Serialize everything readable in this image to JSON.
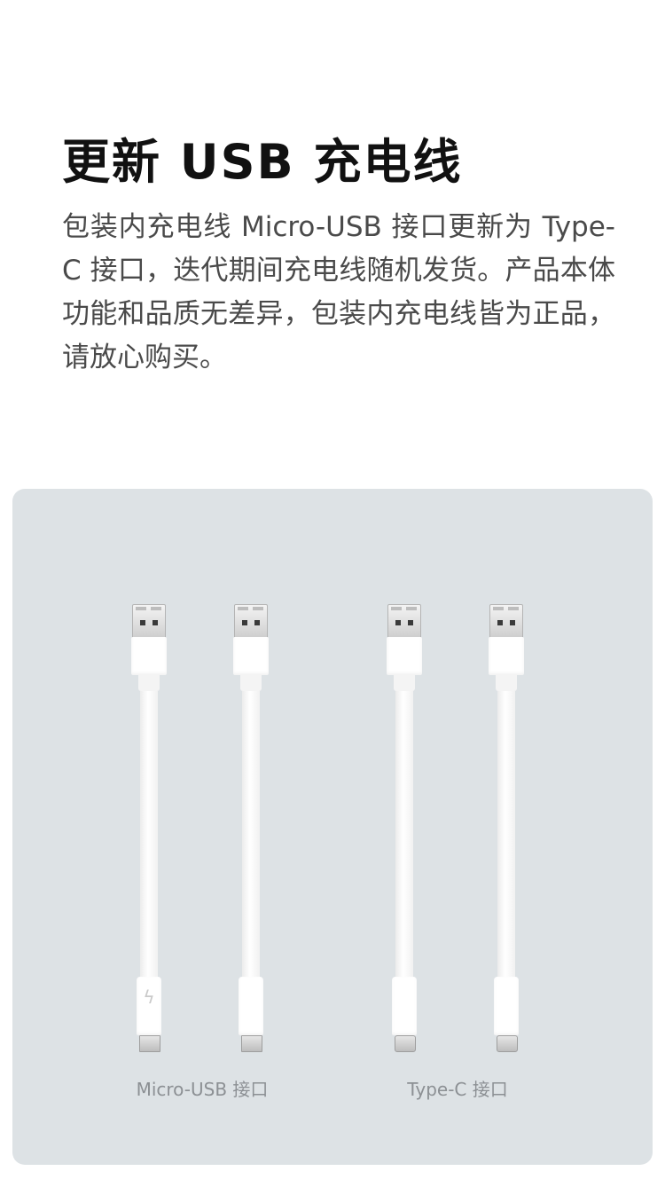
{
  "heading": {
    "title": "更新 USB 充电线"
  },
  "description": "包装内充电线 Micro-USB 接口更新为 Type-C 接口，迭代期间充电线随机发货。产品本体功能和品质无差异，包装内充电线皆为正品，请放心购买。",
  "figure": {
    "background_color": "#dde2e5",
    "cables": [
      {
        "connector": "micro-usb",
        "bolt_icon": "lightning-bolt-icon"
      },
      {
        "connector": "micro-usb"
      },
      {
        "connector": "type-c"
      },
      {
        "connector": "type-c"
      }
    ],
    "labels": {
      "micro_usb": "Micro-USB 接口",
      "type_c": "Type-C 接口"
    }
  }
}
